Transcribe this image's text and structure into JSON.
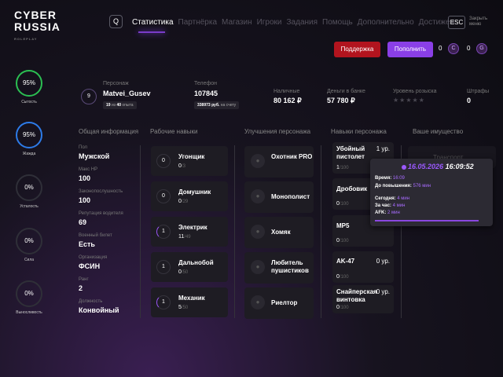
{
  "logo": {
    "line1": "CYBER",
    "line2": "RUSSIA",
    "sub": "ROLEPLAY"
  },
  "header": {
    "search_label": "Q",
    "tabs": [
      "Статистика",
      "Партнёрка",
      "Магазин",
      "Игроки",
      "Задания",
      "Помощь",
      "Дополнительно",
      "Достижен"
    ],
    "active_tab": "Статистика",
    "esc_label": "ESC",
    "close_menu_label": "Закрыть меню"
  },
  "actions": {
    "support_label": "Поддержка",
    "topup_label": "Пополнить"
  },
  "currencies": [
    {
      "value": "0",
      "icon": "C"
    },
    {
      "value": "0",
      "icon": "G"
    }
  ],
  "needs": [
    {
      "percent": "95%",
      "label": "Сытость",
      "color": "green"
    },
    {
      "percent": "95%",
      "label": "Жажда",
      "color": "blue"
    },
    {
      "percent": "0%",
      "label": "Усталость",
      "color": "gray"
    },
    {
      "percent": "0%",
      "label": "Сила",
      "color": "gray"
    },
    {
      "percent": "0%",
      "label": "Выносливость",
      "color": "gray"
    }
  ],
  "player": {
    "level": "9",
    "character_label": "Персонаж",
    "character_name": "Matvei_Gusev",
    "exp_current": "19",
    "exp_of": "из",
    "exp_total": "40",
    "exp_suffix": "опыта",
    "phone_label": "Телефон",
    "phone": "107845",
    "balance_amount": "338973 руб.",
    "balance_suffix": "на счету",
    "cash_label": "Наличные",
    "cash": "80 162 ₽",
    "bank_label": "Деньги в банке",
    "bank": "57 780 ₽",
    "wanted_label": "Уровень розыска",
    "wanted_stars": "★★★★★",
    "fines_label": "Штрафы",
    "fines": "0"
  },
  "columns": {
    "general": "Общая информация",
    "work_skills": "Рабочие навыки",
    "upgrades": "Улучшения персонажа",
    "perks": "Навыки персонажа",
    "property": "Ваше имущество"
  },
  "general_info": [
    {
      "label": "Пол",
      "value": "Мужской"
    },
    {
      "label": "Макс HP",
      "value": "100"
    },
    {
      "label": "Законопослушность",
      "value": "100"
    },
    {
      "label": "Репутация водителя",
      "value": "69"
    },
    {
      "label": "Военный билет",
      "value": "Есть"
    },
    {
      "label": "Организация",
      "value": "ФСИН"
    },
    {
      "label": "Ранг",
      "value": "2"
    },
    {
      "label": "Должность",
      "value": "Конвойный"
    }
  ],
  "work_skills": [
    {
      "level": "0",
      "name": "Угонщик",
      "progress": "0",
      "max": "/3"
    },
    {
      "level": "0",
      "name": "Домушник",
      "progress": "0",
      "max": "/29"
    },
    {
      "level": "1",
      "name": "Электрик",
      "progress": "11",
      "max": "/49"
    },
    {
      "level": "1",
      "name": "Дальнобой",
      "progress": "0",
      "max": "/50"
    },
    {
      "level": "1",
      "name": "Механик",
      "progress": "5",
      "max": "/50"
    }
  ],
  "upgrades": [
    {
      "name": "Охотник PRO"
    },
    {
      "name": "Монополист"
    },
    {
      "name": "Хомяк"
    },
    {
      "name": "Любитель пушистиков"
    },
    {
      "name": "Риелтор"
    }
  ],
  "perks": [
    {
      "name": "Убойный пистолет",
      "progress": "1",
      "max": "/100",
      "level": "1 ур."
    },
    {
      "name": "Дробовик",
      "progress": "0",
      "max": "/100",
      "level": ""
    },
    {
      "name": "MP5",
      "progress": "0",
      "max": "/100",
      "level": ""
    },
    {
      "name": "AK-47",
      "progress": "0",
      "max": "/100",
      "level": "0 ур."
    },
    {
      "name": "Снайперская винтовка",
      "progress": "0",
      "max": "/100",
      "level": "0 ур."
    }
  ],
  "property_item": "Транспорт",
  "tooltip": {
    "date": "16.05.2026",
    "time": "16:09:52",
    "time_label": "Время:",
    "time_value": "16:09",
    "promo_label": "До повышения:",
    "promo_value": "576 мин",
    "today_label": "Сегодня:",
    "today_value": "4 мин",
    "hour_label": "За час:",
    "hour_value": "4 мин",
    "afk_label": "AFK:",
    "afk_value": "2 мин"
  }
}
